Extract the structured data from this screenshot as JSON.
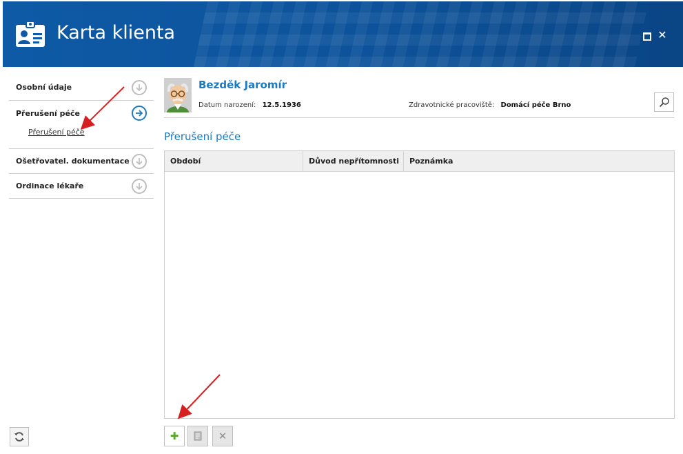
{
  "window": {
    "title": "Karta klienta",
    "maximize_icon": "maximize-icon",
    "close_icon": "close-icon",
    "close_glyph": "✕"
  },
  "sidebar": {
    "items": [
      {
        "label": "Osobní údaje",
        "state": "collapsed"
      },
      {
        "label": "Přerušení péče",
        "state": "active",
        "sub_items": [
          "Přerušení péče"
        ]
      },
      {
        "label": "Ošetřovatel. dokumentace",
        "state": "collapsed"
      },
      {
        "label": "Ordinace lékaře",
        "state": "collapsed"
      }
    ]
  },
  "client": {
    "name": "Bezděk Jaromír",
    "birth_label": "Datum narození:",
    "birth_value": "12.5.1936",
    "workplace_label": "Zdravotnické pracoviště:",
    "workplace_value": "Domácí péče Brno"
  },
  "section": {
    "title": "Přerušení péče"
  },
  "table": {
    "columns": [
      "Období",
      "Důvod nepřítomnosti",
      "Poznámka"
    ],
    "rows": []
  },
  "toolbar": {
    "add_glyph": "✚",
    "delete_glyph": "✕"
  },
  "colors": {
    "header_blue": "#0e5aa6",
    "accent_blue": "#1a7ac4",
    "add_green": "#5aa832",
    "annotation_red": "#d42020"
  }
}
